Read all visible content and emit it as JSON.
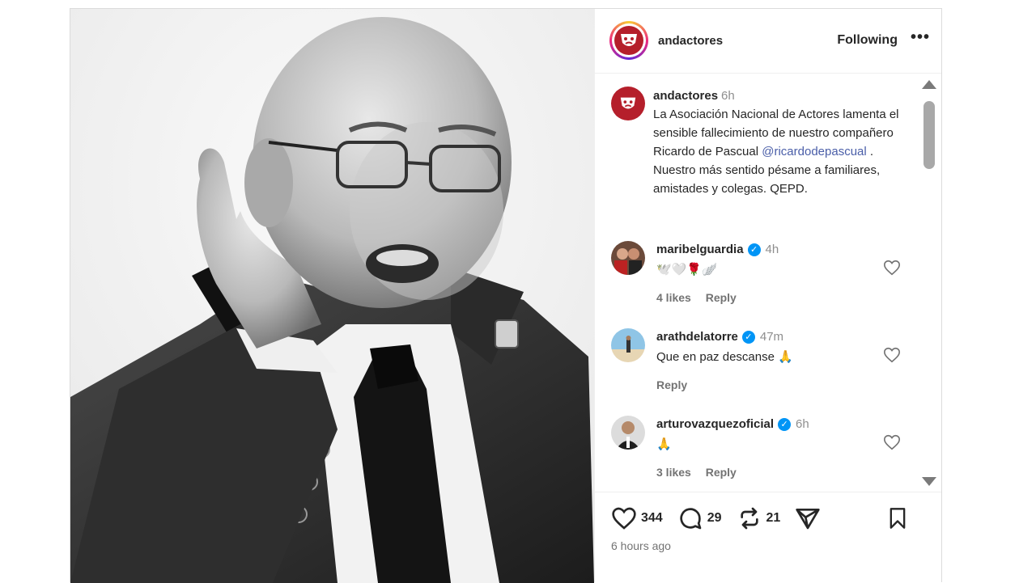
{
  "header": {
    "username": "andactores",
    "follow_label": "Following",
    "more_label": "•••"
  },
  "caption": {
    "username": "andactores",
    "time": "6h",
    "text_before": "La Asociación Nacional de Actores lamenta el sensible fallecimiento de nuestro compañero Ricardo de Pascual ",
    "mention": "@ricardodepascual",
    "text_after": " . Nuestro más sentido pésame a familiares, amistades y colegas.  QEPD."
  },
  "comments": [
    {
      "username": "maribelguardia",
      "time": "4h",
      "text": "🕊️🤍🌹🪽",
      "likes": "4 likes",
      "reply": "Reply"
    },
    {
      "username": "arathdelatorre",
      "time": "47m",
      "text": "Que en paz descanse 🙏",
      "likes": "",
      "reply": "Reply"
    },
    {
      "username": "arturovazquezoficial",
      "time": "6h",
      "text": "🙏",
      "likes": "3 likes",
      "reply": "Reply"
    }
  ],
  "actions": {
    "likes": "344",
    "comments": "29",
    "reposts": "21",
    "time_ago": "6 hours ago"
  },
  "colors": {
    "brand_red": "#b51f2b",
    "verified_blue": "#0095f6",
    "mention_blue": "#4a5ea8"
  }
}
